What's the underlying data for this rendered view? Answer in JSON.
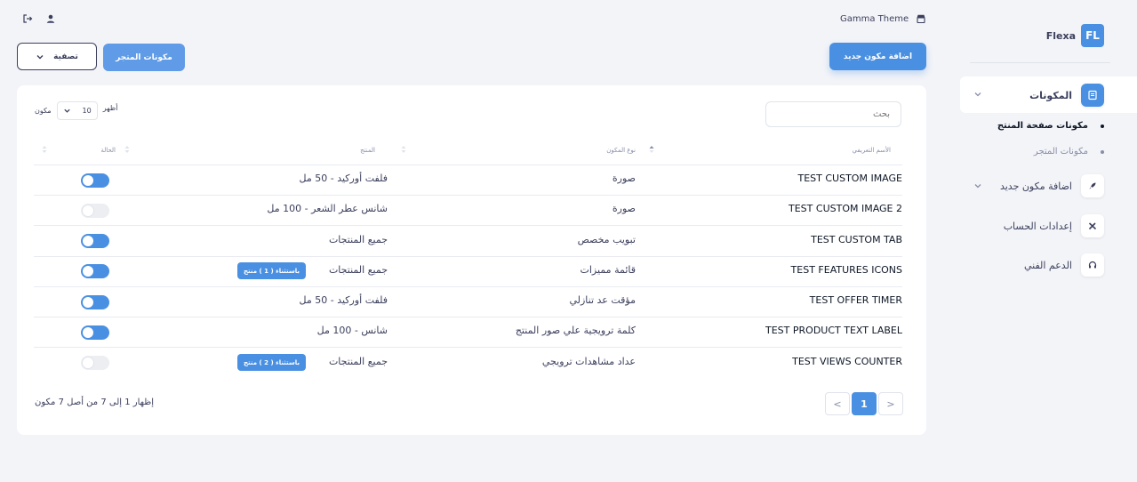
{
  "brand": {
    "logo": "FL",
    "name": "Flexa"
  },
  "sidebar": {
    "items": [
      {
        "label": "المكونات",
        "icon": "document-icon"
      },
      {
        "label": "اضافة مكون جديد",
        "icon": "rocket-icon"
      },
      {
        "label": "إعدادات الحساب",
        "icon": "tools-icon"
      },
      {
        "label": "الدعم الفني",
        "icon": "headset-icon"
      }
    ],
    "sub_items": [
      {
        "label": "مكونات صفحة المنتج"
      },
      {
        "label": "مكونات المتجر"
      }
    ]
  },
  "header": {
    "theme": "Gamma Theme",
    "icons": [
      "logout-icon",
      "user-icon",
      "store-icon"
    ]
  },
  "actions": {
    "add_label": "اضافة مكون جديد",
    "store_label": "مكونات المتجر",
    "filter_label": "تصفية"
  },
  "table": {
    "search_placeholder": "بحث",
    "show_before": "أظهر",
    "page_size": "10",
    "show_after": "مكون",
    "columns": {
      "name": "الأسم التعريفي",
      "type": "نوع المكون",
      "product": "المنتج",
      "status": "الحالة"
    },
    "rows": [
      {
        "name": "TEST CUSTOM IMAGE",
        "type": "صورة",
        "product": "فلفت أوركيد - 50 مل",
        "badge": "",
        "enabled": true
      },
      {
        "name": "TEST CUSTOM IMAGE 2",
        "type": "صورة",
        "product": "شانس عطر الشعر - 100 مل",
        "badge": "",
        "enabled": false
      },
      {
        "name": "TEST CUSTOM TAB",
        "type": "تبويب مخصص",
        "product": "جميع المنتجات",
        "badge": "",
        "enabled": true
      },
      {
        "name": "TEST FEATURES ICONS",
        "type": "قائمة مميزات",
        "product": "جميع المنتجات",
        "badge": "باستثناء ( 1 ) منتج",
        "enabled": true
      },
      {
        "name": "TEST OFFER TIMER",
        "type": "مؤقت عد تنازلي",
        "product": "فلفت أوركيد - 50 مل",
        "badge": "",
        "enabled": true
      },
      {
        "name": "TEST PRODUCT TEXT LABEL",
        "type": "كلمة ترويجية علي صور المنتج",
        "product": "شانس - 100 مل",
        "badge": "",
        "enabled": true
      },
      {
        "name": "TEST VIEWS COUNTER",
        "type": "عداد مشاهدات ترويجي",
        "product": "جميع المنتجات",
        "badge": "باستثناء ( 2 ) منتج",
        "enabled": false
      }
    ],
    "footer": "إظهار 1 إلى 7 من أصل 7 مكون",
    "pagination": {
      "prev": "<",
      "current": "1",
      "next": ">"
    }
  },
  "colors": {
    "accent": "#4a90e2",
    "background": "#f3f4f8",
    "text": "#3b3f5c"
  }
}
